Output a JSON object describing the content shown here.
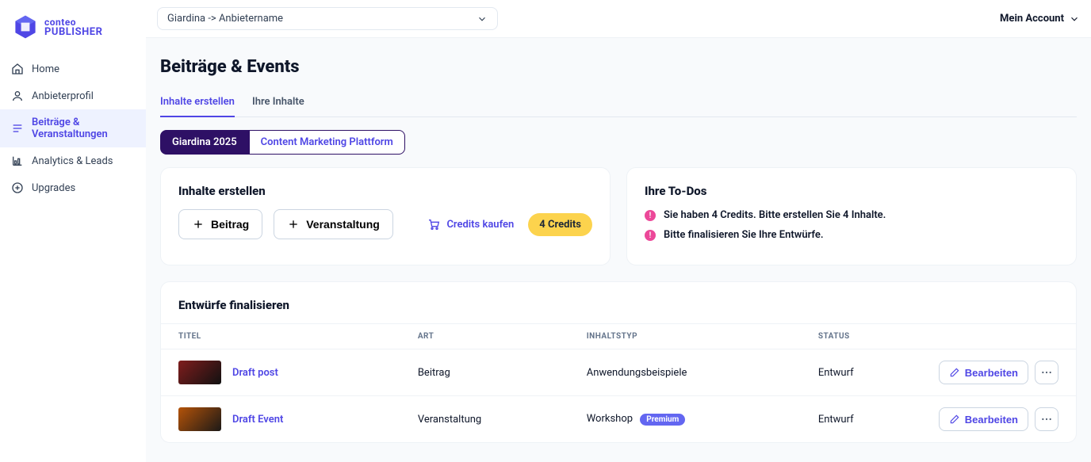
{
  "brand": {
    "line1": "conteo",
    "line2": "PUBLISHER"
  },
  "topbar": {
    "selector_label": "Giardina -> Anbietername",
    "account_label": "Mein Account"
  },
  "sidebar": {
    "items": [
      {
        "label": "Home"
      },
      {
        "label": "Anbieterprofil"
      },
      {
        "label": "Beiträge & Veranstaltungen"
      },
      {
        "label": "Analytics & Leads"
      },
      {
        "label": "Upgrades"
      }
    ]
  },
  "page_title": "Beiträge & Events",
  "tabs": [
    {
      "label": "Inhalte erstellen",
      "active": true
    },
    {
      "label": "Ihre Inhalte",
      "active": false
    }
  ],
  "pills": [
    {
      "label": "Giardina 2025",
      "active": true
    },
    {
      "label": "Content Marketing Plattform",
      "active": false
    }
  ],
  "create_card": {
    "title": "Inhalte erstellen",
    "button_post": "Beitrag",
    "button_event": "Veranstaltung",
    "buy_credits": "Credits kaufen",
    "credit_badge": "4 Credits"
  },
  "todos_card": {
    "title": "Ihre To-Dos",
    "items": [
      "Sie haben 4 Credits. Bitte erstellen Sie 4 Inhalte.",
      "Bitte finalisieren Sie Ihre Entwürfe."
    ]
  },
  "drafts": {
    "title": "Entwürfe finalisieren",
    "columns": {
      "title": "TITEL",
      "kind": "ART",
      "type": "INHALTSTYP",
      "status": "STATUS"
    },
    "edit_label": "Bearbeiten",
    "rows": [
      {
        "title": "Draft post",
        "kind": "Beitrag",
        "type": "Anwendungsbeispiele",
        "premium": false,
        "status": "Entwurf"
      },
      {
        "title": "Draft Event",
        "kind": "Veranstaltung",
        "type": "Workshop",
        "premium": true,
        "premium_label": "Premium",
        "status": "Entwurf"
      }
    ]
  }
}
